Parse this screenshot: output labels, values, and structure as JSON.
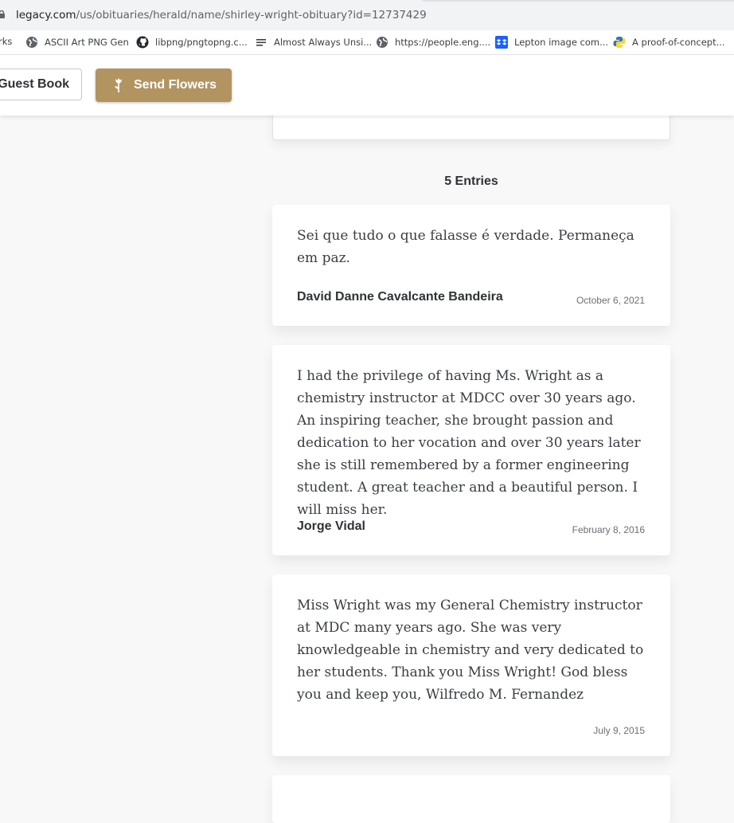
{
  "browser": {
    "url_host": "legacy.com",
    "url_path": "/us/obituaries/herald/name/shirley-wright-obituary?id=12737429",
    "bookmarks": [
      {
        "label": "rks",
        "icon": "none"
      },
      {
        "label": "ASCII Art PNG Gen",
        "icon": "globe-icon"
      },
      {
        "label": "libpng/pngtopng.c...",
        "icon": "github-icon"
      },
      {
        "label": "Almost Always Unsi...",
        "icon": "lines-icon"
      },
      {
        "label": "https://people.eng....",
        "icon": "globe-icon"
      },
      {
        "label": "Lepton image com...",
        "icon": "dropbox-icon"
      },
      {
        "label": "A proof-of-concept...",
        "icon": "python-icon"
      }
    ]
  },
  "header": {
    "guest_book_label": "Guest Book",
    "send_flowers_label": "Send Flowers",
    "accent_color": "#b29461"
  },
  "guestbook": {
    "entries_count_label": "5 Entries",
    "entries": [
      {
        "message": "Sei que tudo o que falasse é verdade. Permaneça em paz.",
        "author": "David Danne Cavalcante Bandeira",
        "date": "October 6, 2021"
      },
      {
        "message": "I had the privilege of having Ms. Wright as a chemistry instructor at MDCC over 30 years ago. An inspiring teacher, she brought passion and dedication to her vocation and over 30 years later she is still remembered by a former engineering student. A great teacher and a beautiful person. I will miss her.",
        "author": "Jorge Vidal",
        "date": "February 8, 2016"
      },
      {
        "message": "Miss Wright was my General Chemistry instructor at MDC many years ago. She was very knowledgeable in chemistry and very dedicated to her students. Thank you Miss Wright! God bless you and keep you, Wilfredo M. Fernandez",
        "author": "",
        "date": "July 9, 2015"
      }
    ]
  }
}
